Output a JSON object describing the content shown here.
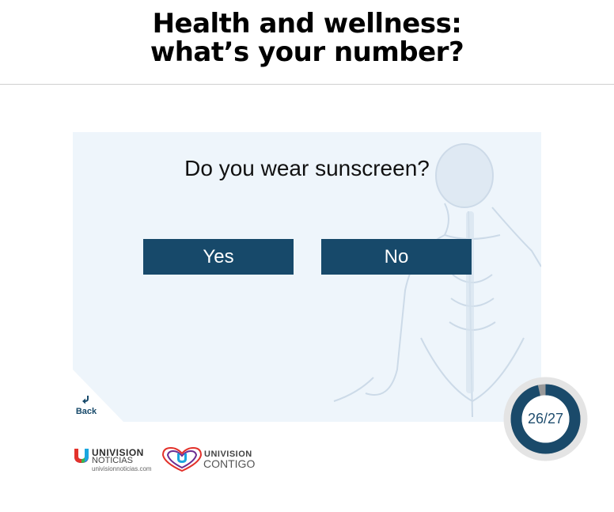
{
  "header": {
    "title_line1": "Health and wellness:",
    "title_line2": "what’s your number?"
  },
  "quiz": {
    "question": "Do you wear sunscreen?",
    "answers": [
      {
        "label": "Yes"
      },
      {
        "label": "No"
      }
    ],
    "back_label": "Back",
    "back_icon": "back-arrow-icon",
    "background_image": "human-skeleton-illustration"
  },
  "progress": {
    "text": "26/27",
    "current": 26,
    "total": 27,
    "colors": {
      "fill": "#1a4a6a",
      "track": "#9a9a9a",
      "outer": "#e4e4e4"
    }
  },
  "logos": {
    "univision_noticias": {
      "brand": "UNIVISION",
      "name": "NOTICIAS",
      "url_text": "univisionnoticias.com"
    },
    "univision_contigo": {
      "brand": "UNIVISION",
      "name": "CONTIGO"
    }
  },
  "colors": {
    "button_bg": "#17496a",
    "button_text": "#ffffff",
    "panel_bg": "#eef5fb"
  }
}
